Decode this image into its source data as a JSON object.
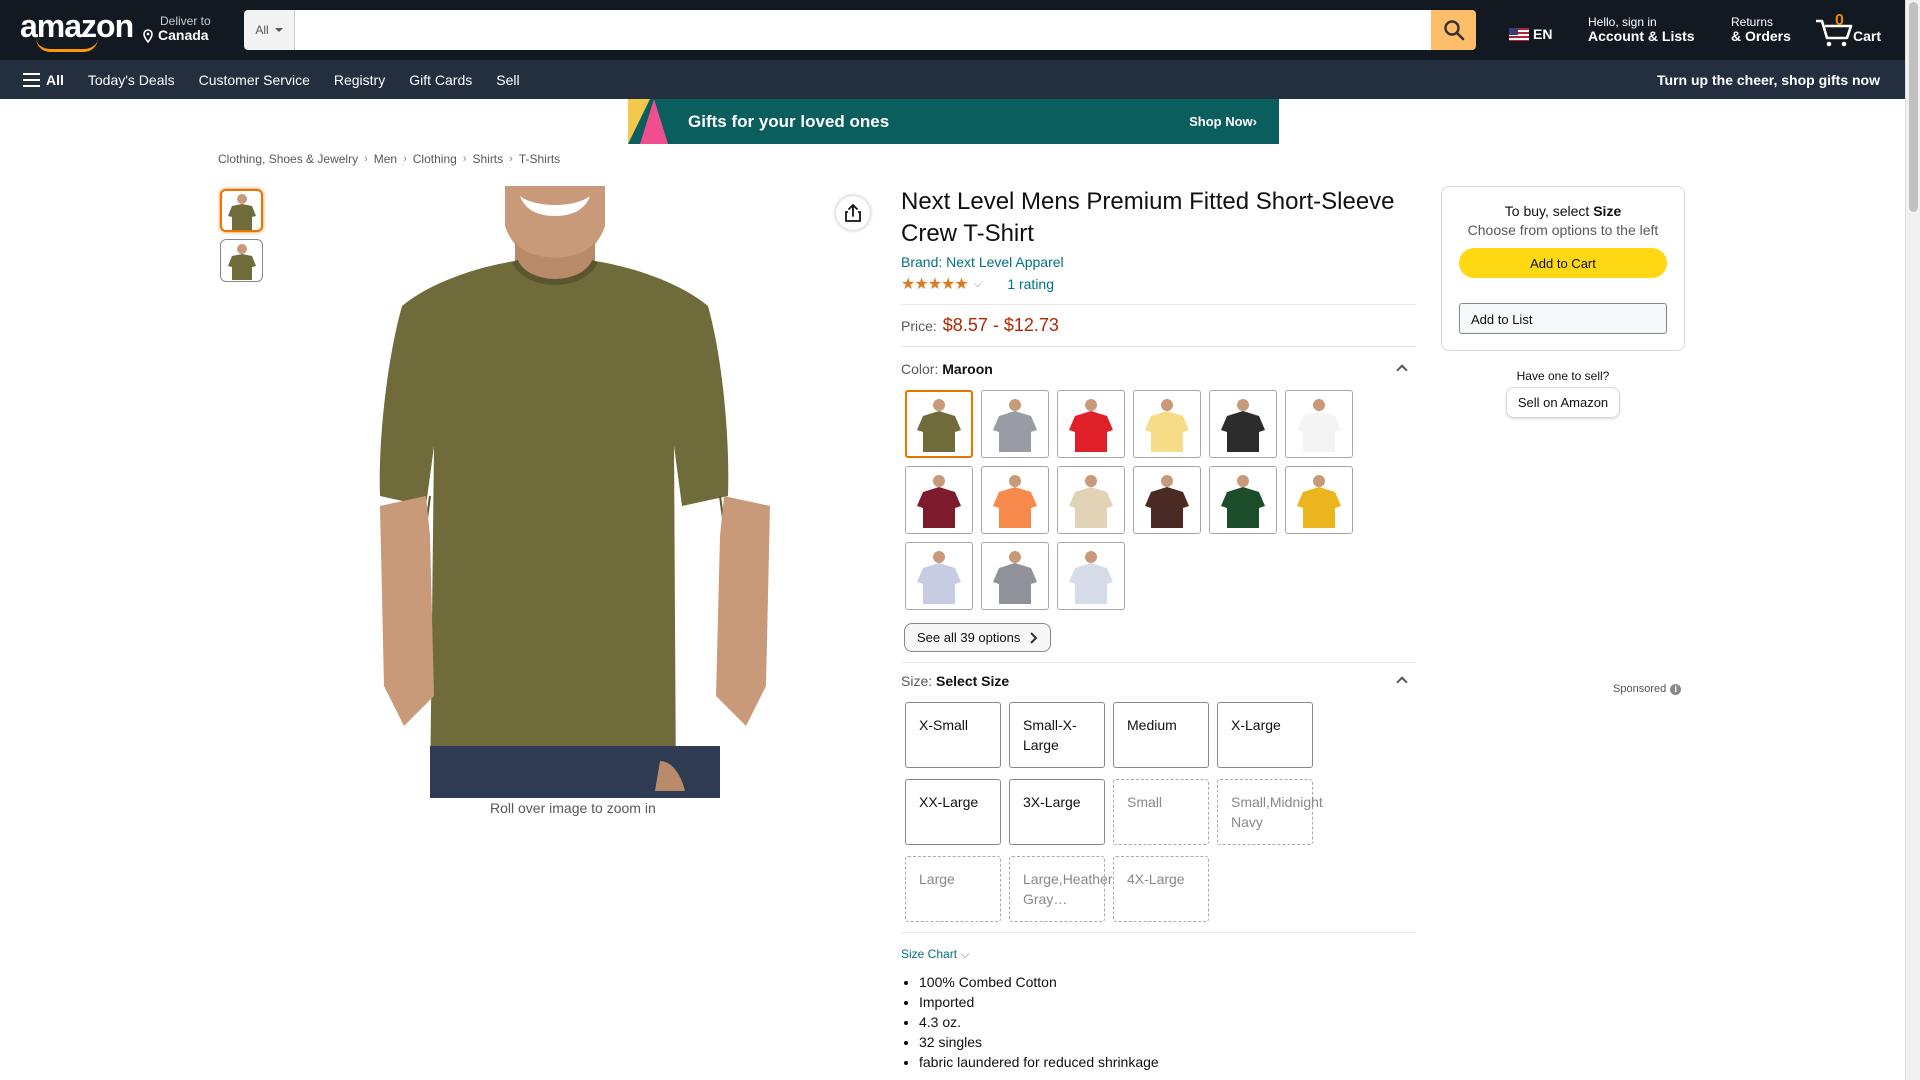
{
  "header": {
    "logo_text": "amazon",
    "deliver_line1": "Deliver to",
    "deliver_line2": "Canada",
    "search_dept": "All",
    "search_placeholder": "",
    "lang": "EN",
    "account_line1": "Hello, sign in",
    "account_line2": "Account & Lists",
    "returns_line1": "Returns",
    "returns_line2": "& Orders",
    "cart_count": "0",
    "cart_label": "Cart"
  },
  "subnav": {
    "all_label": "All",
    "items": [
      "Today's Deals",
      "Customer Service",
      "Registry",
      "Gift Cards",
      "Sell"
    ],
    "promo": "Turn up the cheer, shop gifts now"
  },
  "banner": {
    "text": "Gifts for your loved ones",
    "cta": "Shop Now›"
  },
  "breadcrumbs": [
    "Clothing, Shoes & Jewelry",
    "Men",
    "Clothing",
    "Shirts",
    "T-Shirts"
  ],
  "gallery": {
    "zoom_hint": "Roll over image to zoom in"
  },
  "product": {
    "title": "Next Level Mens Premium Fitted Short-Sleeve Crew T-Shirt",
    "brand": "Brand: Next Level Apparel",
    "stars": "★★★★★",
    "rating_count": "1 rating",
    "price_label": "Price:",
    "price": "$8.57 - $12.73",
    "color_label": "Color:",
    "color_value": "Maroon",
    "swatch_colors": [
      "#6f6b3b",
      "#9a9ca3",
      "#e02029",
      "#f6dc88",
      "#2c2c2c",
      "#f4f4f4",
      "#7d1a2c",
      "#f78a4a",
      "#e2d2b6",
      "#4c2a24",
      "#1c4d2b",
      "#eab51f",
      "#c8cce3",
      "#8f9298",
      "#d6dce8"
    ],
    "see_all": "See all 39 options",
    "size_label": "Size:",
    "size_value": "Select Size",
    "sizes": [
      {
        "label": "X-Small",
        "available": true
      },
      {
        "label": "Small-X-Large",
        "available": true
      },
      {
        "label": "Medium",
        "available": true
      },
      {
        "label": "X-Large",
        "available": true
      },
      {
        "label": "XX-Large",
        "available": true
      },
      {
        "label": "3X-Large",
        "available": true
      },
      {
        "label": "Small",
        "available": false
      },
      {
        "label": "Small,Midnight Navy",
        "available": false
      },
      {
        "label": "Large",
        "available": false
      },
      {
        "label": "Large,Heather Gray…",
        "available": false
      },
      {
        "label": "4X-Large",
        "available": false
      }
    ],
    "size_chart": "Size Chart",
    "bullets": [
      "100% Combed Cotton",
      "Imported",
      "4.3 oz.",
      "32 singles",
      "fabric laundered for reduced shrinkage"
    ]
  },
  "buybox": {
    "line1_prefix": "To buy, select",
    "line1_bold": "Size",
    "line2": "Choose from options to the left",
    "add_to_cart": "Add to Cart",
    "add_to_list": "Add to List"
  },
  "sell": {
    "question": "Have one to sell?",
    "button": "Sell on Amazon"
  },
  "sponsored": "Sponsored",
  "colors": {
    "nav_bg": "#131921",
    "subnav_bg": "#232f3e",
    "accent": "#ff9900",
    "price": "#b12704",
    "link": "#007185",
    "cart_button": "#ffd814",
    "search_button": "#febd69",
    "shirt": "#6f6b3b"
  }
}
